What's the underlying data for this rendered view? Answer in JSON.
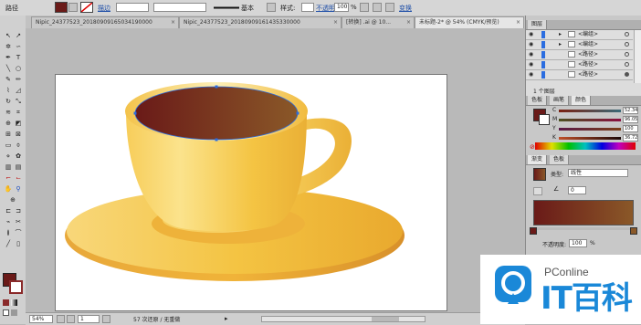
{
  "control_bar": {
    "mode_label": "路径",
    "stroke_label": "描边",
    "profile_label": "基本",
    "style_label": "样式:",
    "opacity_label": "不透明度:",
    "opacity_value": "100",
    "opacity_unit": "%",
    "transform_label": "变换"
  },
  "tabs": [
    {
      "label": "Nipic_24377523_20180909165034190000",
      "active": false
    },
    {
      "label": "Nipic_24377523_20180909161435330000",
      "active": false
    },
    {
      "label": "[转换] .ai @ 10...",
      "active": false
    },
    {
      "label": "未标题-2* @ 54% (CMYK/预览)",
      "active": true
    }
  ],
  "status_bar": {
    "zoom": "54%",
    "page": "1",
    "status_text": "57 次还原 / 无重做"
  },
  "layers_panel": {
    "tab": "图层",
    "items": [
      {
        "name": "<编组>"
      },
      {
        "name": "<编组>"
      },
      {
        "name": "<路径>"
      },
      {
        "name": "<路径>"
      },
      {
        "name": "<路径>"
      }
    ],
    "footer": "1 个图层"
  },
  "color_panel": {
    "tabs": [
      "色板",
      "画笔",
      "颜色"
    ],
    "channels": [
      {
        "label": "C",
        "value": "52.34"
      },
      {
        "label": "M",
        "value": "96.05"
      },
      {
        "label": "Y",
        "value": "100"
      },
      {
        "label": "K",
        "value": "36.72"
      }
    ]
  },
  "gradient_panel": {
    "tabs": [
      "渐变",
      "色板"
    ],
    "type_label": "类型:",
    "type_value": "线性",
    "angle_value": "0",
    "opacity_label": "不透明度:",
    "opacity_value": "100",
    "percent": "%"
  },
  "watermark": {
    "brand": "PConline",
    "sub": "IT百科"
  },
  "colors": {
    "coffee_dark": "#6a1a18",
    "coffee_light": "#8a5828",
    "cup_yellow": "#f4c443",
    "saucer_yellow": "#f1c14a",
    "selection_blue": "#2b6de0",
    "watermark_blue": "#1a88d8"
  }
}
